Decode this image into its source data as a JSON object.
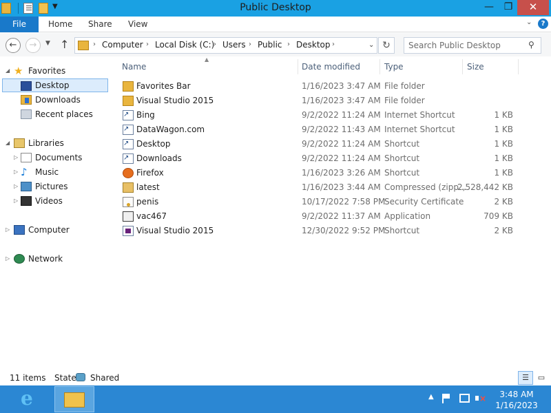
{
  "window": {
    "title": "Public Desktop"
  },
  "ribbon": {
    "file": "File",
    "tabs": [
      "Home",
      "Share",
      "View"
    ],
    "help": "?"
  },
  "nav": {
    "back": "←",
    "forward": "→",
    "up": "↑",
    "breadcrumb": [
      "Computer",
      "Local Disk (C:)",
      "Users",
      "Public",
      "Desktop"
    ],
    "search_placeholder": "Search Public Desktop"
  },
  "sidebar": {
    "favorites": {
      "label": "Favorites",
      "items": [
        "Desktop",
        "Downloads",
        "Recent places"
      ],
      "selected": "Desktop"
    },
    "libraries": {
      "label": "Libraries",
      "items": [
        "Documents",
        "Music",
        "Pictures",
        "Videos"
      ]
    },
    "computer": "Computer",
    "network": "Network"
  },
  "columns": {
    "name": "Name",
    "date": "Date modified",
    "type": "Type",
    "size": "Size"
  },
  "files": [
    {
      "name": "Favorites Bar",
      "date": "1/16/2023 3:47 AM",
      "type": "File folder",
      "size": "",
      "icon": "folder-icon"
    },
    {
      "name": "Visual Studio 2015",
      "date": "1/16/2023 3:47 AM",
      "type": "File folder",
      "size": "",
      "icon": "folder-icon"
    },
    {
      "name": "Bing",
      "date": "9/2/2022 11:24 AM",
      "type": "Internet Shortcut",
      "size": "1 KB",
      "icon": "internet-shortcut-icon"
    },
    {
      "name": "DataWagon.com",
      "date": "9/2/2022 11:43 AM",
      "type": "Internet Shortcut",
      "size": "1 KB",
      "icon": "internet-shortcut-icon"
    },
    {
      "name": "Desktop",
      "date": "9/2/2022 11:24 AM",
      "type": "Shortcut",
      "size": "1 KB",
      "icon": "shortcut-icon"
    },
    {
      "name": "Downloads",
      "date": "9/2/2022 11:24 AM",
      "type": "Shortcut",
      "size": "1 KB",
      "icon": "shortcut-icon"
    },
    {
      "name": "Firefox",
      "date": "1/16/2023 3:26 AM",
      "type": "Shortcut",
      "size": "1 KB",
      "icon": "firefox-icon"
    },
    {
      "name": "latest",
      "date": "1/16/2023 3:44 AM",
      "type": "Compressed (zipp...",
      "size": "2,528,442 KB",
      "icon": "zip-icon"
    },
    {
      "name": "penis",
      "date": "10/17/2022 7:58 PM",
      "type": "Security Certificate",
      "size": "2 KB",
      "icon": "certificate-icon"
    },
    {
      "name": "vac467",
      "date": "9/2/2022 11:37 AM",
      "type": "Application",
      "size": "709 KB",
      "icon": "application-icon"
    },
    {
      "name": "Visual Studio 2015",
      "date": "12/30/2022 9:52 PM",
      "type": "Shortcut",
      "size": "2 KB",
      "icon": "visual-studio-icon"
    }
  ],
  "status": {
    "count": "11 items",
    "state_label": "State:",
    "state_value": "Shared"
  },
  "taskbar": {
    "time": "3:48 AM",
    "date": "1/16/2023"
  }
}
